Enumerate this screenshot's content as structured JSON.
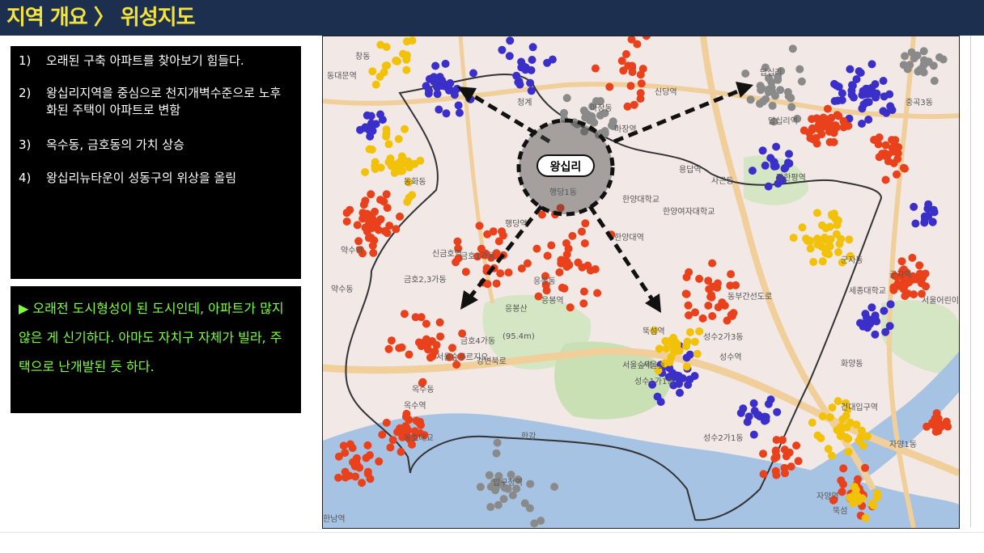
{
  "header": {
    "title": "지역 개요 〉 위성지도"
  },
  "list": [
    {
      "num": "1)",
      "text": "오래된 구축 아파트를 찾아보기 힘들다."
    },
    {
      "num": "2)",
      "text": "왕십리지역을 중심으로 천지개벽수준으로 노후화된 주택이 아파트로 변함"
    },
    {
      "num": "3)",
      "text": "옥수동, 금호동의 가치 상승"
    },
    {
      "num": "4)",
      "text": "왕십리뉴타운이 성동구의 위상을 올림"
    }
  ],
  "note": "▶ 오래전 도시형성이 된 도시인데, 아파트가 많지 않은 게 신기하다. 아마도 자치구 자체가 빌라, 주택으로 난개발된 듯 하다.",
  "map": {
    "center_label": "왕십리",
    "labels": [
      "창동",
      "신당역",
      "동대문역",
      "청계",
      "마장동",
      "마장역",
      "답십리",
      "답십리역",
      "동화동",
      "신금호역",
      "금호1가동",
      "금호2,3가동",
      "행당역",
      "행당1동",
      "한양대역",
      "응봉역",
      "응봉동",
      "응봉산",
      "(95.4m)",
      "금호4가동",
      "서울숲푸르지오",
      "옥수동",
      "옥수역",
      "서울숲역",
      "뚝섬역",
      "성수2가3동",
      "성수역",
      "성수1가1동",
      "성수2가1동",
      "사근동",
      "용답역",
      "장한평역",
      "군자동",
      "군자역",
      "화양동",
      "건대입구역",
      "자양1동",
      "자양역",
      "뚝섬",
      "한남역",
      "동호대교",
      "압구정역",
      "강변북로",
      "한양대학교",
      "한양여자대학교",
      "세종대학교",
      "동부간선도로",
      "서울숲",
      "약수동",
      "약수역",
      "중곡3동",
      "서울어린이대공원",
      "한강"
    ],
    "colors": {
      "water": "#a7c3e4",
      "land": "#f2e8e6",
      "park": "#d4e6c3",
      "road": "#f0cf9a",
      "dot_blue": "#3a2fc8",
      "dot_red": "#e8411c",
      "dot_yellow": "#f2c20a",
      "dot_gray": "#8a8a8a",
      "boundary": "#333333"
    }
  }
}
